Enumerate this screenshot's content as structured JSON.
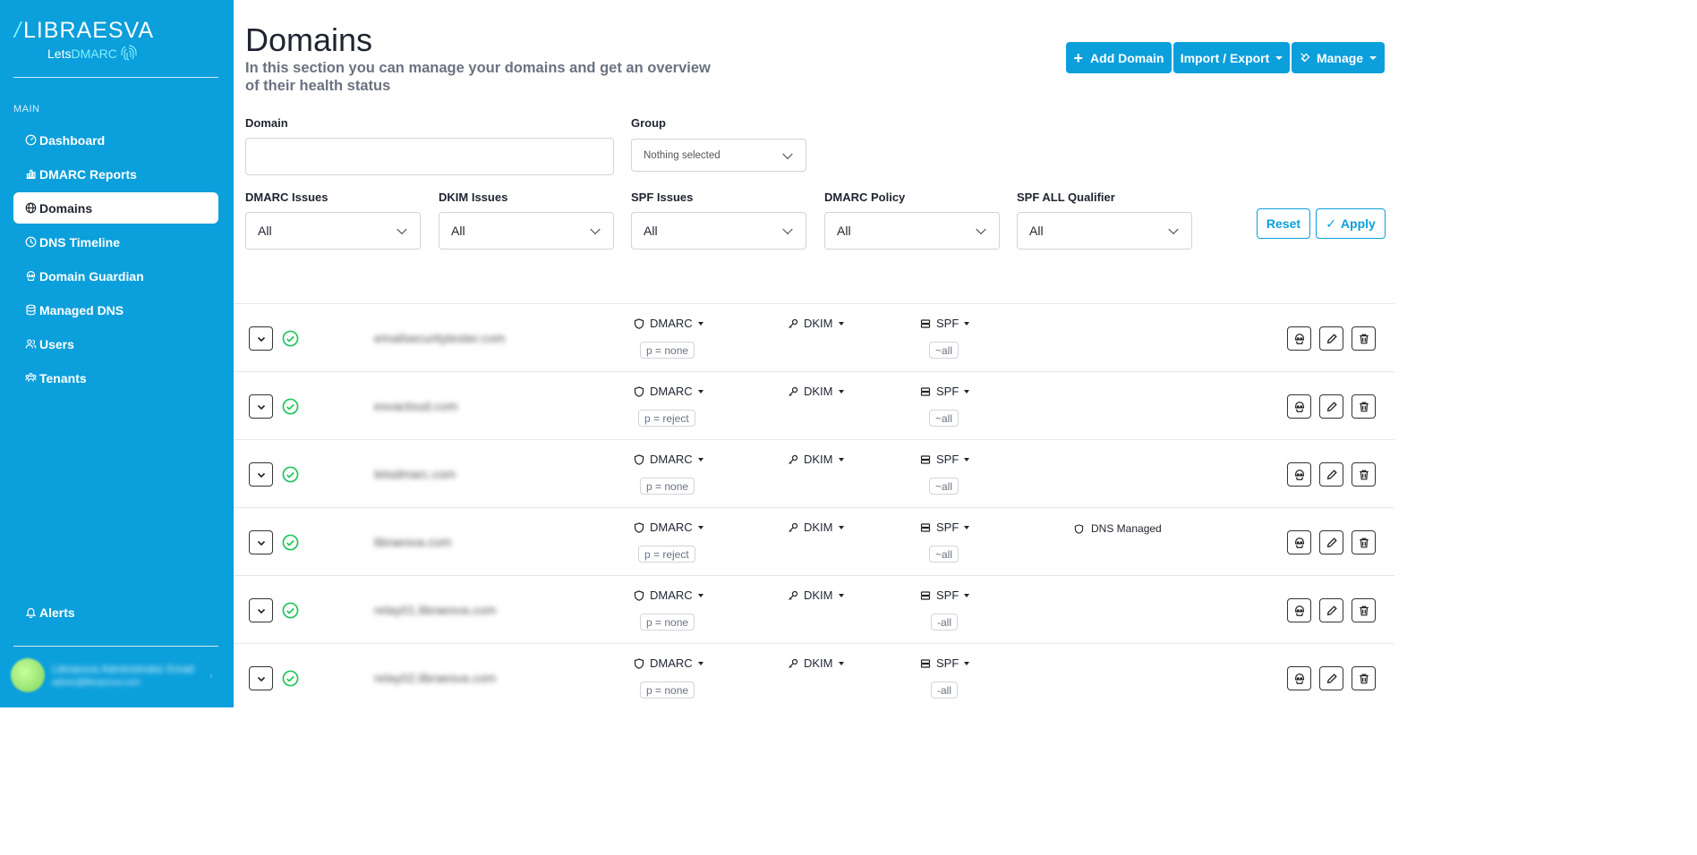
{
  "brand": {
    "name": "LIBRAESVA",
    "sub_prefix": "Lets",
    "sub_highlight": "DMARC"
  },
  "sidebar": {
    "section": "MAIN",
    "items": [
      {
        "label": "Dashboard",
        "icon": "gauge-icon"
      },
      {
        "label": "DMARC Reports",
        "icon": "chart-icon"
      },
      {
        "label": "Domains",
        "icon": "globe-icon",
        "active": true
      },
      {
        "label": "DNS Timeline",
        "icon": "clock-icon"
      },
      {
        "label": "Domain Guardian",
        "icon": "guardian-icon"
      },
      {
        "label": "Managed DNS",
        "icon": "database-icon"
      },
      {
        "label": "Users",
        "icon": "users-icon"
      },
      {
        "label": "Tenants",
        "icon": "tenants-icon"
      }
    ],
    "alerts": "Alerts",
    "user": {
      "name": "Libraesva Administrator Email",
      "email": "admin@libraesva.com"
    }
  },
  "header": {
    "title": "Domains",
    "subtitle": "In this section you can manage your domains and get an overview of their health status",
    "add_domain": "Add Domain",
    "import_export": "Import / Export",
    "manage": "Manage"
  },
  "filters": {
    "domain_label": "Domain",
    "domain_value": "",
    "group_label": "Group",
    "group_value": "Nothing selected",
    "dmarc_issues_label": "DMARC Issues",
    "dmarc_issues_value": "All",
    "dkim_issues_label": "DKIM Issues",
    "dkim_issues_value": "All",
    "spf_issues_label": "SPF Issues",
    "spf_issues_value": "All",
    "dmarc_policy_label": "DMARC Policy",
    "dmarc_policy_value": "All",
    "spf_all_label": "SPF ALL Qualifier",
    "spf_all_value": "All",
    "reset": "Reset",
    "apply": "Apply"
  },
  "labels": {
    "dmarc": "DMARC",
    "dkim": "DKIM",
    "spf": "SPF"
  },
  "rows": [
    {
      "domain": "emailsecuritytester.com",
      "dmarc_policy": "p = none",
      "spf_qualifier": "~all",
      "status": ""
    },
    {
      "domain": "esvacloud.com",
      "dmarc_policy": "p = reject",
      "spf_qualifier": "~all",
      "status": ""
    },
    {
      "domain": "letsdmarc.com",
      "dmarc_policy": "p = none",
      "spf_qualifier": "~all",
      "status": ""
    },
    {
      "domain": "libraesva.com",
      "dmarc_policy": "p = reject",
      "spf_qualifier": "~all",
      "status": "DNS Managed"
    },
    {
      "domain": "relay01.libraesva.com",
      "dmarc_policy": "p = none",
      "spf_qualifier": "-all",
      "status": ""
    },
    {
      "domain": "relay02.libraesva.com",
      "dmarc_policy": "p = none",
      "spf_qualifier": "-all",
      "status": ""
    }
  ]
}
